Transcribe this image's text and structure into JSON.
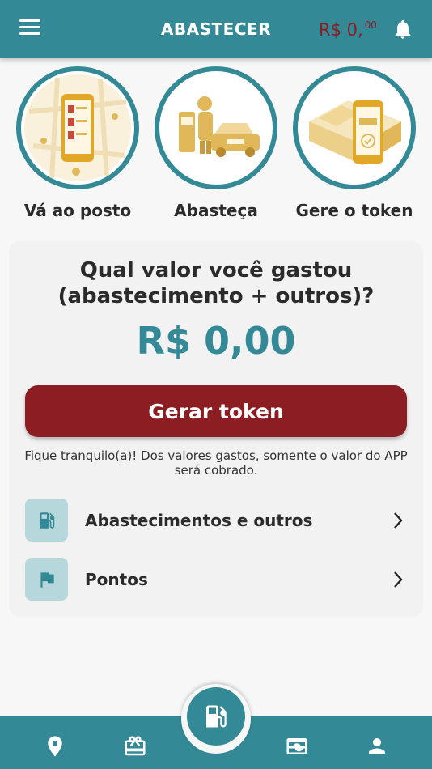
{
  "header": {
    "title": "ABASTECER",
    "balance_main": "R$ 0,",
    "balance_cents": "00",
    "menu_icon": "hamburger-menu-icon",
    "bell_icon": "bell-icon"
  },
  "steps": [
    {
      "label": "Vá ao posto",
      "icon": "map-phone-illustration"
    },
    {
      "label": "Abasteça",
      "icon": "fueling-car-illustration"
    },
    {
      "label": "Gere o token",
      "icon": "token-phone-illustration"
    }
  ],
  "card": {
    "question_line1": "Qual valor você gastou",
    "question_line2": "(abastecimento + outros)?",
    "amount": "R$ 0,00",
    "button_label": "Gerar token",
    "notice": "Fique tranquilo(a)! Dos valores gastos, somente o valor do APP será cobrado.",
    "rows": [
      {
        "label": "Abastecimentos e outros",
        "icon": "fuel-pump-icon"
      },
      {
        "label": "Pontos",
        "icon": "flag-icon"
      }
    ]
  },
  "bottom_nav": {
    "tabs": [
      "location-pin-icon",
      "gift-card-icon",
      "fuel-pump-icon",
      "wallet-icon",
      "user-icon"
    ]
  },
  "colors": {
    "primary": "#338a96",
    "accent": "#8c1d22",
    "illustration_gold": "#e0b85a",
    "icon_tile": "#b6d7db"
  }
}
